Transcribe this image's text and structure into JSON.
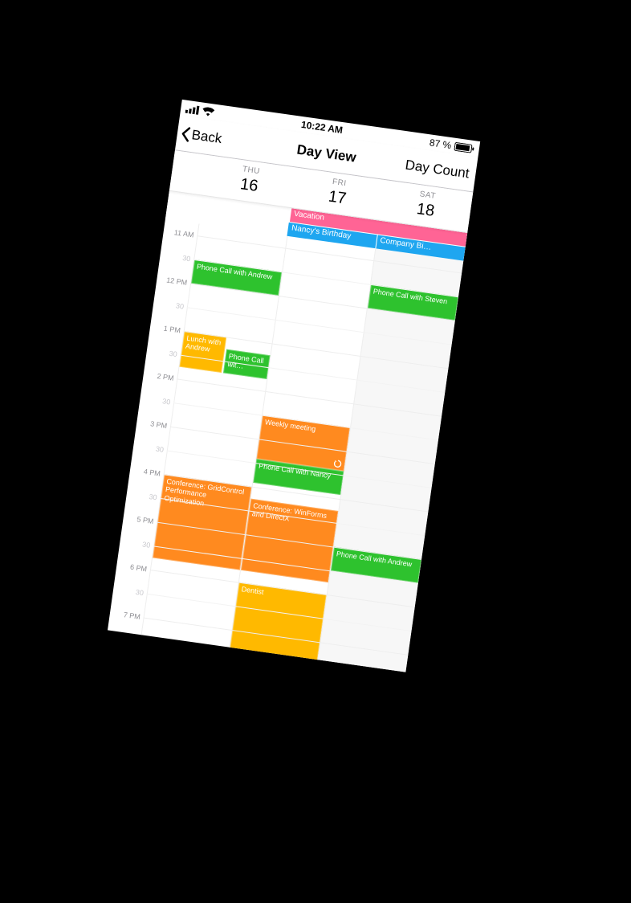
{
  "statusBar": {
    "time": "10:22 AM",
    "batteryText": "87 %"
  },
  "nav": {
    "back": "Back",
    "title": "Day View",
    "right": "Day Count"
  },
  "days": [
    {
      "dow": "THU",
      "num": "16"
    },
    {
      "dow": "FRI",
      "num": "17"
    },
    {
      "dow": "SAT",
      "num": "18"
    }
  ],
  "alldayEvents": {
    "vacation": "Vacation",
    "nancyBirthday": "Nancy's Birthday",
    "companyBi": "Company Bi…"
  },
  "timeLabels": {
    "h11": "11 AM",
    "m1130": "30",
    "h12": "12 PM",
    "m1230": "30",
    "h13": "1 PM",
    "m1330": "30",
    "h14": "2 PM",
    "m1430": "30",
    "h15": "3 PM",
    "m1530": "30",
    "h16": "4 PM",
    "m1630": "30",
    "h17": "5 PM",
    "m1730": "30",
    "h18": "6 PM",
    "m1830": "30",
    "h19": "7 PM"
  },
  "events": {
    "thu": {
      "phoneAndrew": "Phone Call with Andrew",
      "lunchAndrew": "Lunch with Andrew",
      "phoneCallShort": "Phone Call wit…",
      "confGrid": "Conference: GridControl Performance Optimization"
    },
    "fri": {
      "weeklyMeeting": "Weekly meeting",
      "phoneNancy": "Phone Call with Nancy",
      "confWinForms": "Conference: WinForms and DirectX",
      "dentist": "Dentist"
    },
    "sat": {
      "phoneSteven": "Phone Call with Steven",
      "phoneAndrew2": "Phone Call with Andrew"
    }
  }
}
